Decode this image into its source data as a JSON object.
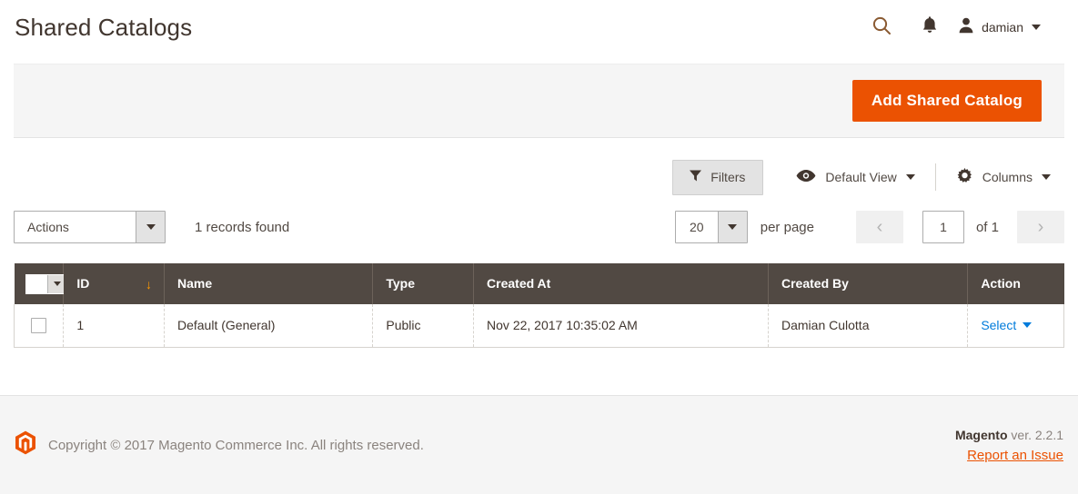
{
  "header": {
    "title": "Shared Catalogs",
    "icons": {
      "search": "search-icon",
      "notifications": "bell-icon",
      "avatar": "user-avatar-icon"
    },
    "user_name": "damian"
  },
  "page_actions": {
    "add_button_label": "Add Shared Catalog"
  },
  "grid_toolbar": {
    "filters_label": "Filters",
    "view_label": "Default View",
    "columns_label": "Columns"
  },
  "grid_controls": {
    "actions_label": "Actions",
    "records_found": "1 records found",
    "per_page_value": "20",
    "per_page_label": "per page",
    "page_value": "1",
    "page_of": "of 1",
    "prev_glyph": "‹",
    "next_glyph": "›"
  },
  "table": {
    "columns": [
      {
        "key": "check",
        "label": ""
      },
      {
        "key": "id",
        "label": "ID"
      },
      {
        "key": "name",
        "label": "Name"
      },
      {
        "key": "type",
        "label": "Type"
      },
      {
        "key": "created_at",
        "label": "Created At"
      },
      {
        "key": "created_by",
        "label": "Created By"
      },
      {
        "key": "action",
        "label": "Action"
      }
    ],
    "sort_column": "ID",
    "sort_arrow": "↓",
    "rows": [
      {
        "id": "1",
        "name": "Default (General)",
        "type": "Public",
        "created_at": "Nov 22, 2017 10:35:02 AM",
        "created_by": "Damian Culotta",
        "action_label": "Select"
      }
    ]
  },
  "footer": {
    "copyright": "Copyright © 2017 Magento Commerce Inc. All rights reserved.",
    "brand": "Magento",
    "version": " ver. 2.2.1",
    "report_link": "Report an Issue"
  },
  "colors": {
    "accent_orange": "#eb5202",
    "header_brown": "#514943",
    "link_blue": "#007bdb",
    "sort_orange": "#ff9900"
  }
}
